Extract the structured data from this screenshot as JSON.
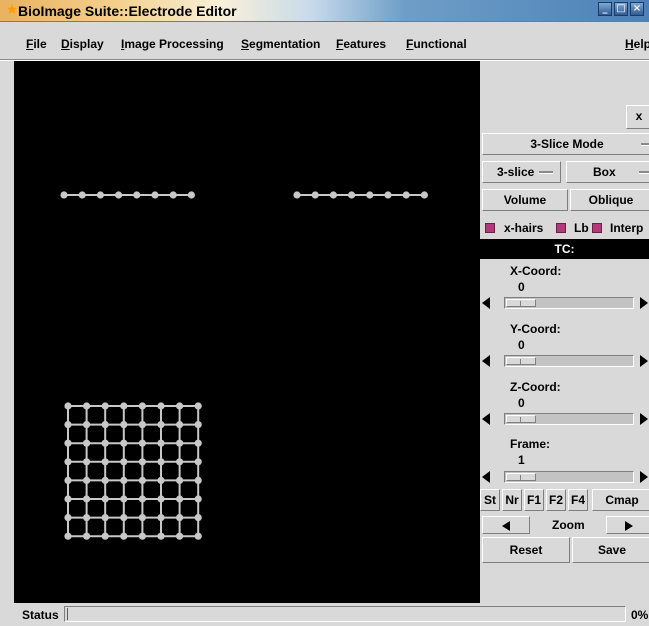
{
  "window": {
    "title": "BioImage Suite::Electrode Editor",
    "controls": [
      "minimize-icon",
      "maximize-icon",
      "close-icon"
    ]
  },
  "menubar": {
    "items": [
      "File",
      "Display",
      "Image Processing",
      "Segmentation",
      "Features",
      "Functional"
    ],
    "help": "Help"
  },
  "viewer": {
    "background": "#000000",
    "electrode_color": "#c8c8c8",
    "strips": [
      {
        "electrodes": 8,
        "rows": 1
      },
      {
        "electrodes": 8,
        "rows": 1
      }
    ],
    "grid": {
      "rows": 8,
      "cols": 8
    }
  },
  "panel": {
    "x_button": "x",
    "mode_button": "3-Slice Mode",
    "view_option": "3-slice",
    "box_option": "Box",
    "volume_button": "Volume",
    "oblique_button": "Oblique",
    "checkboxes": [
      {
        "label": "x-hairs",
        "checked": true
      },
      {
        "label": "Lb",
        "checked": true
      },
      {
        "label": "Interp",
        "checked": true
      }
    ],
    "tc_label": "TC:",
    "coords": [
      {
        "label": "X-Coord:",
        "value": "0"
      },
      {
        "label": "Y-Coord:",
        "value": "0"
      },
      {
        "label": "Z-Coord:",
        "value": "0"
      },
      {
        "label": "Frame:",
        "value": "1"
      }
    ],
    "small_buttons": [
      "St",
      "Nr",
      "F1",
      "F2",
      "F4",
      "Cmap"
    ],
    "zoom_label": "Zoom",
    "reset_button": "Reset",
    "save_button": "Save"
  },
  "status": {
    "label": "Status",
    "progress_percent": 0,
    "progress_text": "0%",
    "accent": "#c0392b"
  }
}
